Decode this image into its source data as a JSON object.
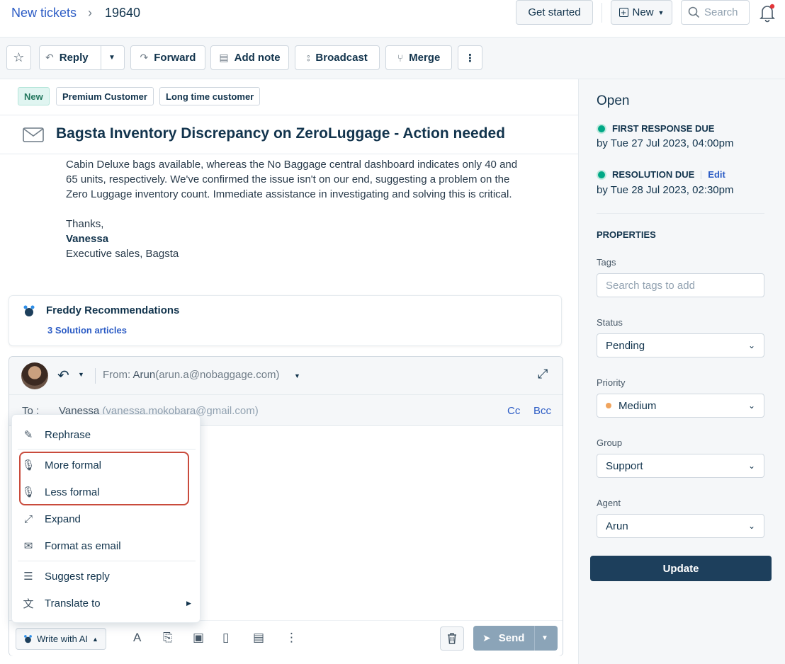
{
  "breadcrumb": {
    "parent": "New tickets",
    "separator": "›",
    "ticket_id": "19640"
  },
  "topbar": {
    "get_started": "Get started",
    "new_label": "New",
    "search_placeholder": "Search"
  },
  "toolbar": {
    "reply": "Reply",
    "forward": "Forward",
    "add_note": "Add note",
    "broadcast": "Broadcast",
    "merge": "Merge",
    "more": "⋮"
  },
  "tags": [
    "New",
    "Premium Customer",
    "Long time customer"
  ],
  "ticket": {
    "subject": "Bagsta Inventory Discrepancy on ZeroLuggage - Action needed",
    "body_lines": [
      "Cabin Deluxe bags available, whereas the No Baggage central dashboard indicates only 40 and",
      "65 units, respectively. We've confirmed the issue isn't on our end, suggesting a problem on the",
      "Zero Luggage inventory count. Immediate assistance in investigating and solving this is critical."
    ],
    "sign_off": "Thanks,",
    "sender_name": "Vanessa",
    "sender_title": "Executive sales, Bagsta"
  },
  "freddy": {
    "title": "Freddy Recommendations",
    "link": "3 Solution articles"
  },
  "composer": {
    "from_label": "From:",
    "from_name": "Arun",
    "from_email": "(arun.a@nobaggage.com)",
    "to_label": "To :",
    "to_name": "Vanessa",
    "to_email": "(vanessa.mokobara@gmail.com)",
    "cc": "Cc",
    "bcc": "Bcc",
    "write_ai": "Write with AI",
    "send": "Send"
  },
  "ai_menu": {
    "items": [
      {
        "label": "Rephrase",
        "icon": "✎"
      },
      {
        "label": "More formal",
        "icon": "🎙"
      },
      {
        "label": "Less formal",
        "icon": "🎙"
      },
      {
        "label": "Expand",
        "icon": "⤢"
      },
      {
        "label": "Format as email",
        "icon": "✉"
      },
      {
        "label": "Suggest reply",
        "icon": "☰"
      },
      {
        "label": "Translate to",
        "icon": "文"
      }
    ]
  },
  "sidebar": {
    "status": "Open",
    "first_response_label": "FIRST RESPONSE DUE",
    "first_response_value": "by Tue 27 Jul 2023, 04:00pm",
    "resolution_label": "RESOLUTION DUE",
    "resolution_edit": "Edit",
    "resolution_value": "by Tue 28 Jul 2023, 02:30pm",
    "properties_title": "PROPERTIES",
    "tags_label": "Tags",
    "tags_placeholder": "Search tags to add",
    "status_label": "Status",
    "status_value": "Pending",
    "priority_label": "Priority",
    "priority_value": "Medium",
    "group_label": "Group",
    "group_value": "Support",
    "agent_label": "Agent",
    "agent_value": "Arun",
    "update": "Update"
  },
  "colors": {
    "accent": "#2c5cc5",
    "sla_green": "#00a886",
    "priority_medium": "#f0a45d",
    "update_btn": "#1d3f5c",
    "highlight": "#c94b3c"
  }
}
